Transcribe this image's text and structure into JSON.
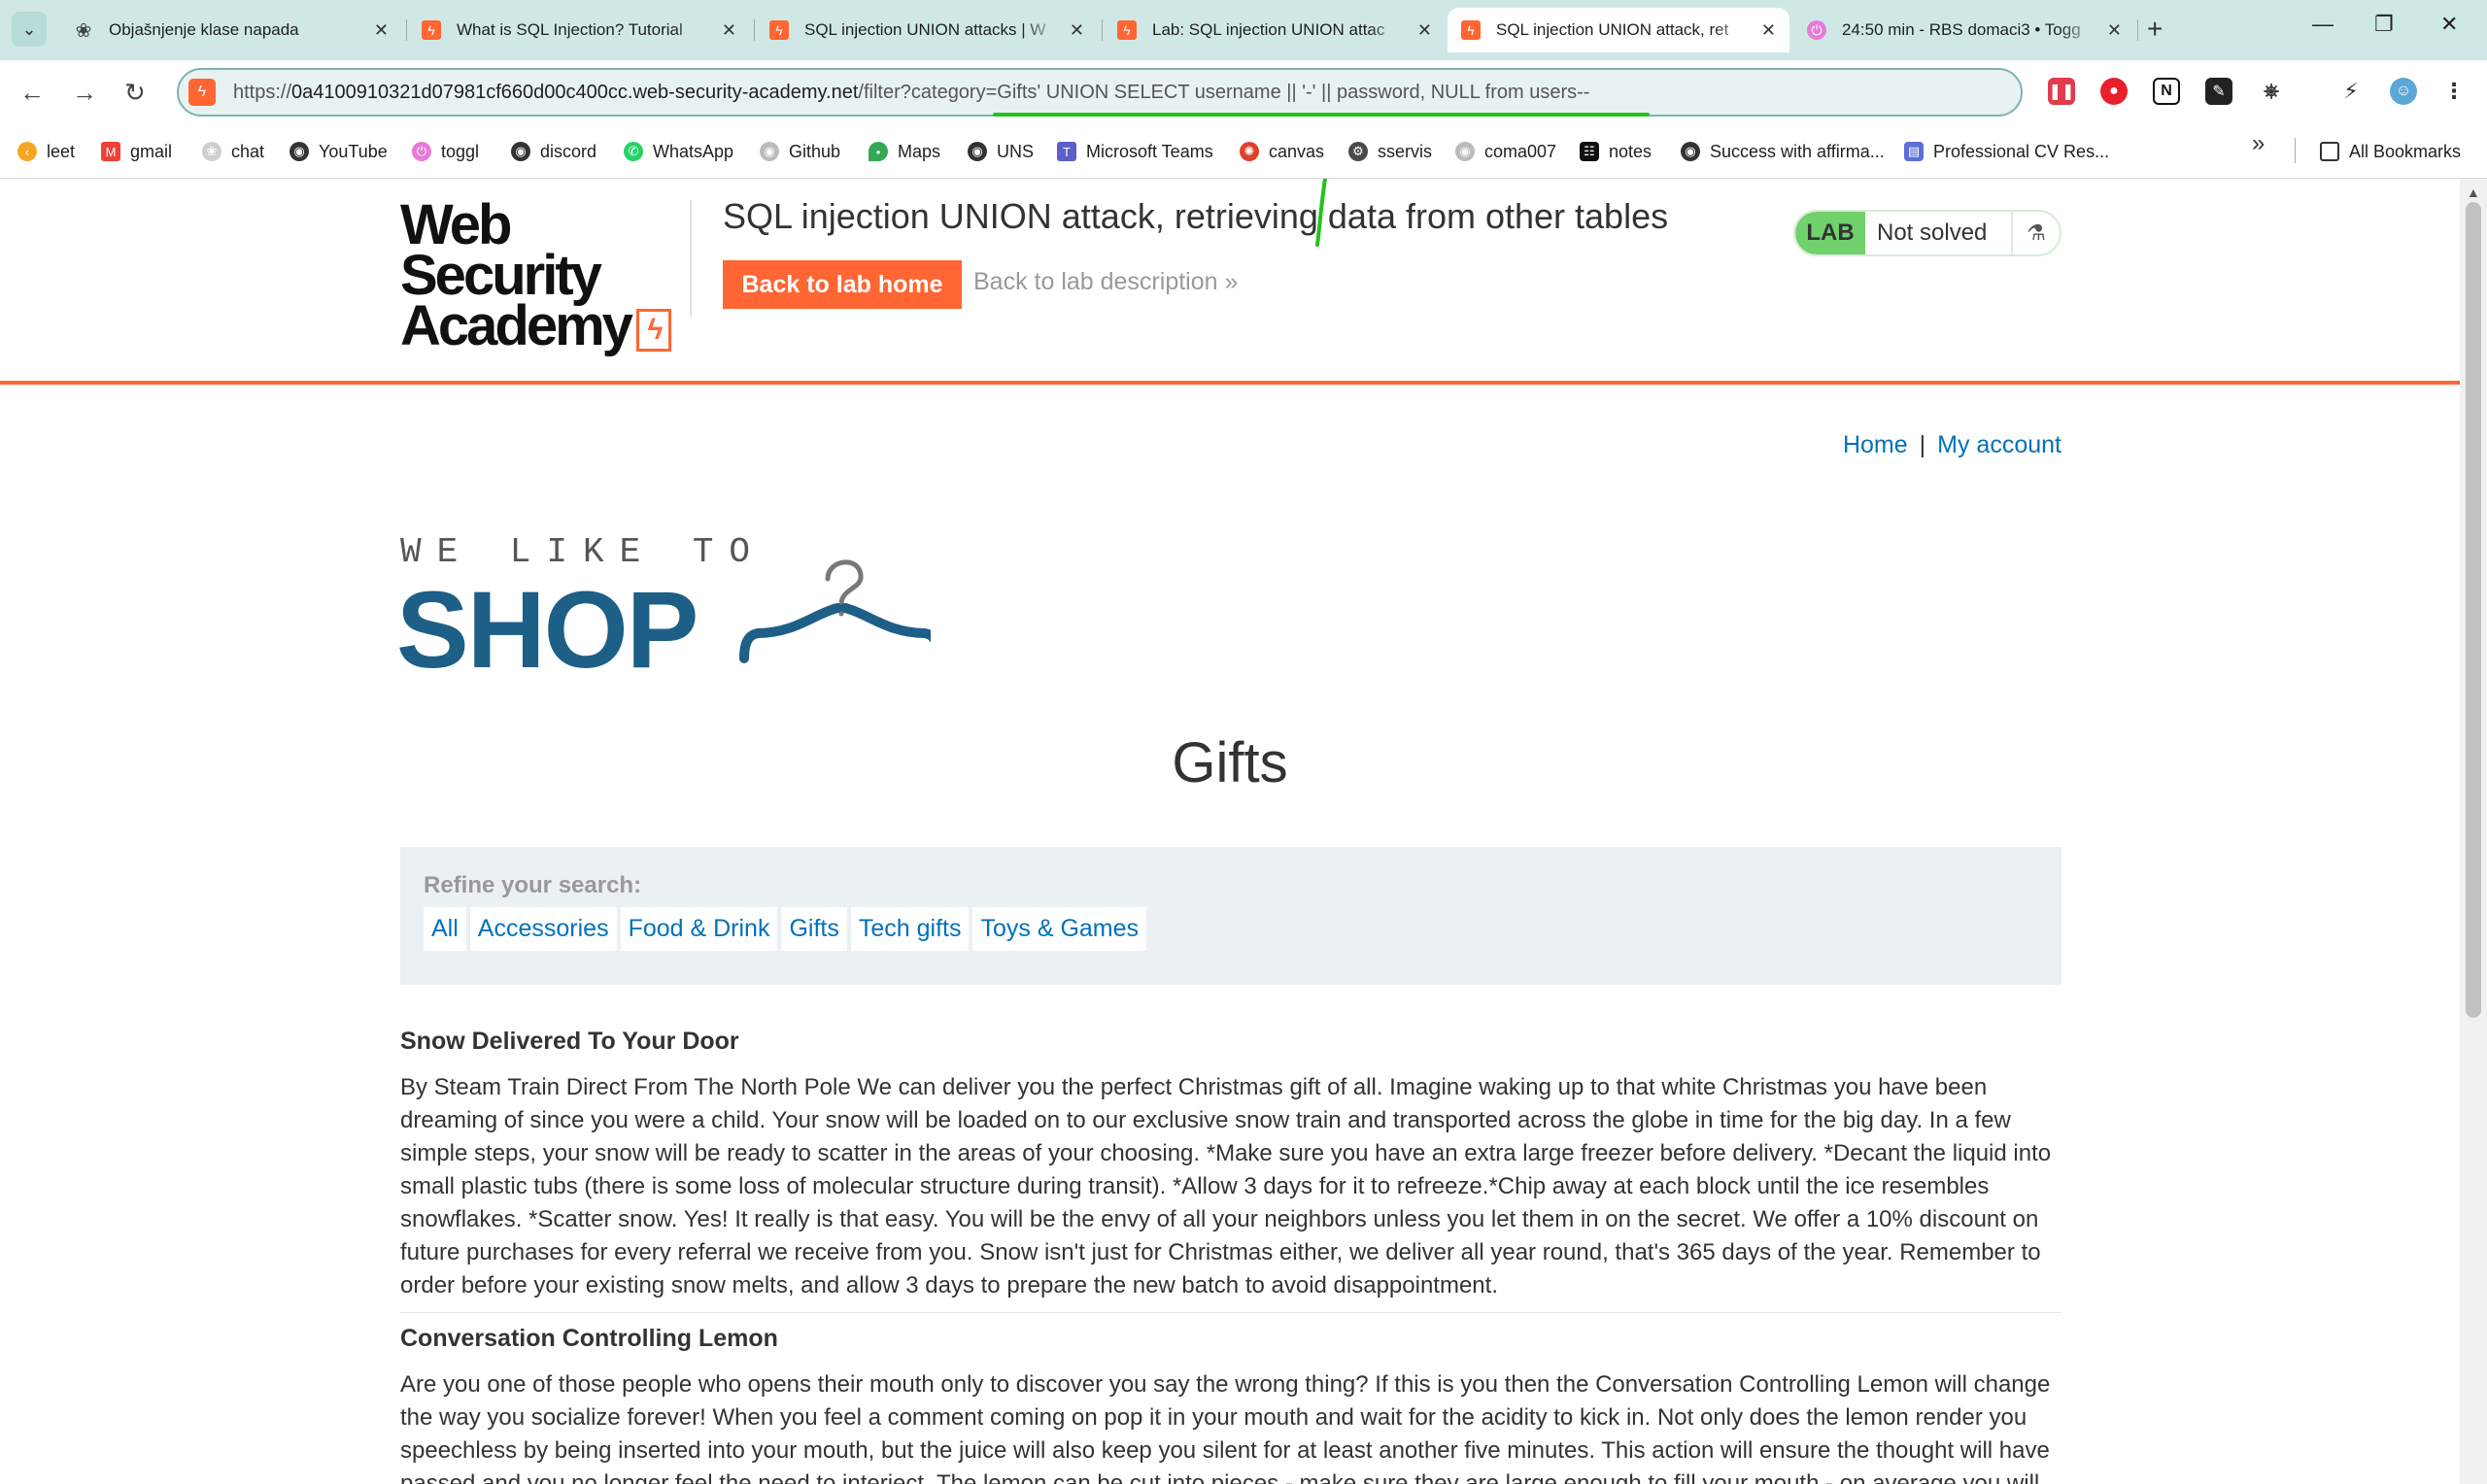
{
  "browser": {
    "tabs": [
      {
        "title": "Objašnjenje klase napada",
        "icon": "chatgpt-icon",
        "active": false
      },
      {
        "title": "What is SQL Injection? Tutorial",
        "icon": "portswigger-icon",
        "active": false
      },
      {
        "title": "SQL injection UNION attacks | W",
        "icon": "portswigger-icon",
        "active": false
      },
      {
        "title": "Lab: SQL injection UNION attac",
        "icon": "portswigger-icon",
        "active": false
      },
      {
        "title": "SQL injection UNION attack, ret",
        "icon": "portswigger-icon",
        "active": true
      },
      {
        "title": "24:50 min - RBS domaci3 • Togg",
        "icon": "toggl-icon",
        "active": false
      }
    ],
    "url": {
      "scheme": "https://",
      "host": "0a4100910321d07981cf660d00c400cc.web-security-academy.net",
      "path": "/filter?category=Gifts' UNION SELECT username || '-' || password, NULL from users--"
    },
    "bookmarks": [
      {
        "label": "leet",
        "icon": "leetcode-icon"
      },
      {
        "label": "gmail",
        "icon": "gmail-icon"
      },
      {
        "label": "chat",
        "icon": "chatgpt-icon"
      },
      {
        "label": "YouTube",
        "icon": "globe-icon"
      },
      {
        "label": "toggl",
        "icon": "toggl-icon"
      },
      {
        "label": "discord",
        "icon": "globe-icon"
      },
      {
        "label": "WhatsApp",
        "icon": "whatsapp-icon"
      },
      {
        "label": "Github",
        "icon": "github-icon"
      },
      {
        "label": "Maps",
        "icon": "maps-icon"
      },
      {
        "label": "UNS",
        "icon": "globe-icon"
      },
      {
        "label": "Microsoft Teams",
        "icon": "teams-icon"
      },
      {
        "label": "canvas",
        "icon": "canvas-icon"
      },
      {
        "label": "sservis",
        "icon": "sservis-icon"
      },
      {
        "label": "coma007",
        "icon": "github-icon"
      },
      {
        "label": "notes",
        "icon": "notes-icon"
      },
      {
        "label": "Success with affirma...",
        "icon": "globe-icon"
      },
      {
        "label": "Professional CV Res...",
        "icon": "cv-icon"
      }
    ],
    "all_bookmarks": "All Bookmarks",
    "colors": {
      "accent": "#22c31b",
      "chrome": "#cfe8e6"
    }
  },
  "lab_header": {
    "logo_line1": "Web Security",
    "logo_line2": "Academy",
    "title": "SQL injection UNION attack, retrieving data from other tables",
    "back_home": "Back to lab home",
    "back_description": "Back to lab description",
    "badge": "LAB",
    "status": "Not solved"
  },
  "nav": {
    "home": "Home",
    "separator": "|",
    "account": "My account"
  },
  "shop_logo": {
    "tagline": "WE LIKE TO",
    "name": "SHOP"
  },
  "category": "Gifts",
  "filter": {
    "label": "Refine your search:",
    "options": [
      "All",
      "Accessories",
      "Food & Drink",
      "Gifts",
      "Tech gifts",
      "Toys & Games"
    ]
  },
  "products": [
    {
      "title": "Snow Delivered To Your Door",
      "description": "By Steam Train Direct From The North Pole We can deliver you the perfect Christmas gift of all. Imagine waking up to that white Christmas you have been dreaming of since you were a child. Your snow will be loaded on to our exclusive snow train and transported across the globe in time for the big day. In a few simple steps, your snow will be ready to scatter in the areas of your choosing. *Make sure you have an extra large freezer before delivery. *Decant the liquid into small plastic tubs (there is some loss of molecular structure during transit). *Allow 3 days for it to refreeze.*Chip away at each block until the ice resembles snowflakes. *Scatter snow. Yes! It really is that easy. You will be the envy of all your neighbors unless you let them in on the secret. We offer a 10% discount on future purchases for every referral we receive from you. Snow isn't just for Christmas either, we deliver all year round, that's 365 days of the year. Remember to order before your existing snow melts, and allow 3 days to prepare the new batch to avoid disappointment."
    },
    {
      "title": "Conversation Controlling Lemon",
      "description": "Are you one of those people who opens their mouth only to discover you say the wrong thing? If this is you then the Conversation Controlling Lemon will change the way you socialize forever! When you feel a comment coming on pop it in your mouth and wait for the acidity to kick in. Not only does the lemon render you speechless by being inserted into your mouth, but the juice will also keep you silent for at least another five minutes. This action will ensure the thought will have passed and you no longer feel the need to interject. The lemon can be cut into pieces - make sure they are large enough to fill your mouth - on average you will"
    }
  ]
}
